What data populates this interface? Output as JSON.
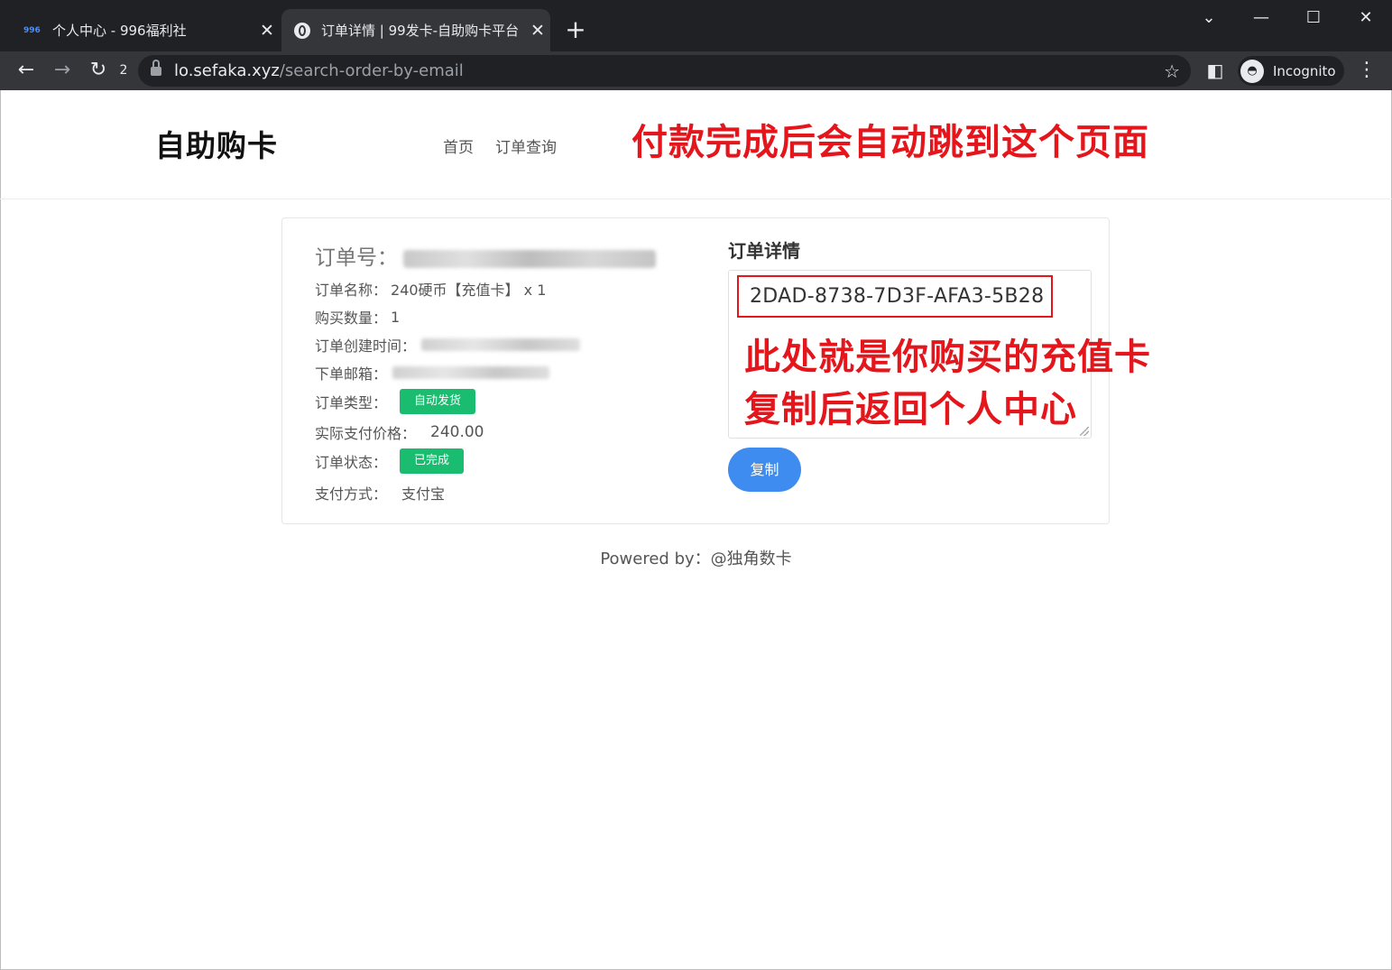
{
  "browser": {
    "tabs": [
      {
        "favicon": "996",
        "title": "个人中心 - 996福利社"
      },
      {
        "favicon": "globe-icon",
        "title": "订单详情 | 99发卡-自助购卡平台"
      }
    ],
    "omnibox": {
      "host": "lo.sefaka.xyz",
      "path": "/search-order-by-email"
    },
    "reload_badge": "2",
    "incognito_label": "Incognito"
  },
  "header": {
    "brand": "自助购卡",
    "nav": [
      "首页",
      "订单查询"
    ],
    "annotation": "付款完成后会自动跳到这个页面"
  },
  "order": {
    "number_label": "订单号：",
    "name_label": "订单名称：",
    "name_value": "240硬币【充值卡】 x 1",
    "qty_label": "购买数量：",
    "qty_value": "1",
    "created_label": "订单创建时间：",
    "email_label": "下单邮箱：",
    "type_label": "订单类型：",
    "type_badge": "自动发货",
    "price_label": "实际支付价格：",
    "price_value": "240.00",
    "status_label": "订单状态：",
    "status_badge": "已完成",
    "pay_label": "支付方式：",
    "pay_value": "支付宝"
  },
  "detail": {
    "title": "订单详情",
    "card_key": "2DAD-8738-7D3F-AFA3-5B28",
    "annotation_line1": "此处就是你购买的充值卡",
    "annotation_line2": "复制后返回个人中心",
    "copy_button": "复制"
  },
  "footer": {
    "text": "Powered by：@独角数卡"
  },
  "colors": {
    "accent_red": "#e4161c",
    "badge_green": "#1abc70",
    "button_blue": "#3f8cf0"
  }
}
